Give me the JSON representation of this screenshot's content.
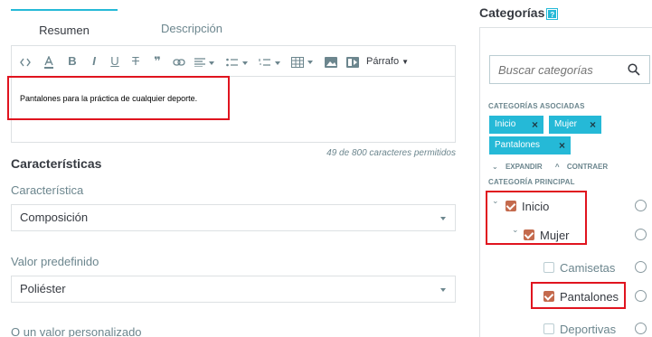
{
  "tabs": [
    {
      "label": "Resumen"
    },
    {
      "label": "Descripción"
    }
  ],
  "toolbar": {
    "format_label": "Párrafo"
  },
  "editor": {
    "content": "Pantalones para la práctica de cualquier deporte.",
    "counter": "49 de 800 caracteres permitidos"
  },
  "features": {
    "title": "Características",
    "feature_label": "Característica",
    "feature_value": "Composición",
    "predefined_label": "Valor predefinido",
    "predefined_value": "Poliéster",
    "custom_label": "O un valor personalizado"
  },
  "categories": {
    "title": "Categorías",
    "help": "?",
    "search_placeholder": "Buscar categorías",
    "associated_label": "CATEGORÍAS ASOCIADAS",
    "chips": [
      "Inicio",
      "Mujer",
      "Pantalones"
    ],
    "expand_label": "EXPANDIR",
    "collapse_label": "CONTRAER",
    "main_label": "CATEGORÍA PRINCIPAL",
    "tree": [
      {
        "label": "Inicio",
        "checked": true
      },
      {
        "label": "Mujer",
        "checked": true
      },
      {
        "label": "Camisetas",
        "checked": false
      },
      {
        "label": "Pantalones",
        "checked": true
      },
      {
        "label": "Deportivas",
        "checked": false
      }
    ]
  },
  "colors": {
    "accent": "#25b9d7",
    "checkbox": "#c46a4d",
    "highlight": "#e0141f"
  }
}
